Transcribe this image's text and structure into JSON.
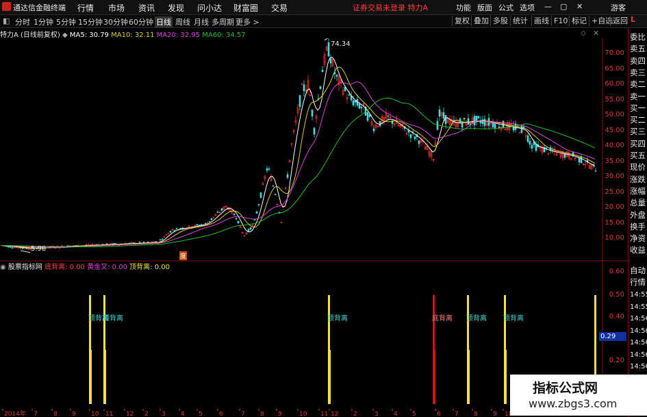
{
  "titlebar": {
    "app_name": "通达信金融终端",
    "menu": [
      "行情",
      "市场",
      "资讯",
      "发现",
      "问小达",
      "财富圈",
      "交易"
    ],
    "notice": "证券交易未登录 特力A",
    "right_menu": [
      "功能",
      "版面",
      "公式",
      "选项"
    ],
    "guest": "游客"
  },
  "periodbar": {
    "periods": [
      "分时",
      "1分钟",
      "5分钟",
      "15分钟",
      "30分钟",
      "60分钟",
      "日线",
      "周线",
      "月线",
      "多周期",
      "更多 >"
    ],
    "active": "日线",
    "buttons": [
      "复权",
      "叠加",
      "多股",
      "统计",
      "画线",
      "F10",
      "标记",
      "+自选",
      "返回"
    ]
  },
  "info": {
    "stock": "特力A (日线前复权)",
    "ma5": "MA5: 30.79",
    "ma10": "MA10: 32.11",
    "ma20": "MA20: 32.95",
    "ma60": "MA60: 34.57",
    "high_label": "74.34",
    "low_label": "5.98",
    "marker": "度"
  },
  "colors": {
    "ma5": "#ffffff",
    "ma10": "#e0d020",
    "ma20": "#e040e0",
    "ma60": "#20c020",
    "up": "#ff3030",
    "down": "#40e0e0",
    "axis": "#d73b3b",
    "signal_yellow": "#f0e040",
    "signal_red": "#e01010"
  },
  "price_axis": [
    "70.00",
    "65.00",
    "60.00",
    "55.00",
    "50.00",
    "45.00",
    "40.00",
    "35.00",
    "30.00",
    "25.00",
    "20.00",
    "15.00",
    "10.00"
  ],
  "indicator": {
    "name": "股票指标网",
    "item1": "底背离: 0.00",
    "item2": "黄金叉: 0.00",
    "item3": "顶背离: 0.00",
    "axis": [
      "0.60",
      "0.50",
      "0.40",
      "0.20"
    ],
    "current": "0.29"
  },
  "signals": [
    {
      "label": "顶背离",
      "kind": "yellow",
      "anchor": "x=131"
    },
    {
      "label": "顶背离",
      "kind": "yellow",
      "anchor": "x=152"
    },
    {
      "label": "顶背离",
      "kind": "yellow",
      "anchor": "x=480"
    },
    {
      "label": "底背离",
      "kind": "red",
      "anchor": "x=633"
    },
    {
      "label": "顶背离",
      "kind": "yellow",
      "anchor": "x=683"
    },
    {
      "label": "顶背离",
      "kind": "yellow",
      "anchor": "x=737"
    }
  ],
  "right_panel": {
    "labels": [
      "委比",
      "卖五",
      "卖四",
      "卖三",
      "卖二",
      "卖一",
      "买一",
      "买二",
      "买三",
      "买四",
      "买五",
      "现价",
      "涨跌",
      "涨幅",
      "总量",
      "外盘",
      "换手",
      "净资",
      "收益"
    ],
    "lower_labels": [
      "自动",
      "行情"
    ],
    "times": [
      "14:55",
      "14:55",
      "14:56",
      "14:56",
      "14:56",
      "14:56",
      "14:56"
    ]
  },
  "date_axis": [
    "2014年",
    "7",
    "8",
    "9",
    "10",
    "11",
    "12",
    "2",
    "3",
    "4",
    "5",
    "6",
    "7",
    "8",
    "9",
    "10",
    "11",
    "12",
    "2",
    "3",
    "4",
    "5",
    "6",
    "7",
    "8",
    "9",
    "10"
  ],
  "watermark": {
    "title": "指标公式网",
    "url": "www.zbgs3.com"
  }
}
